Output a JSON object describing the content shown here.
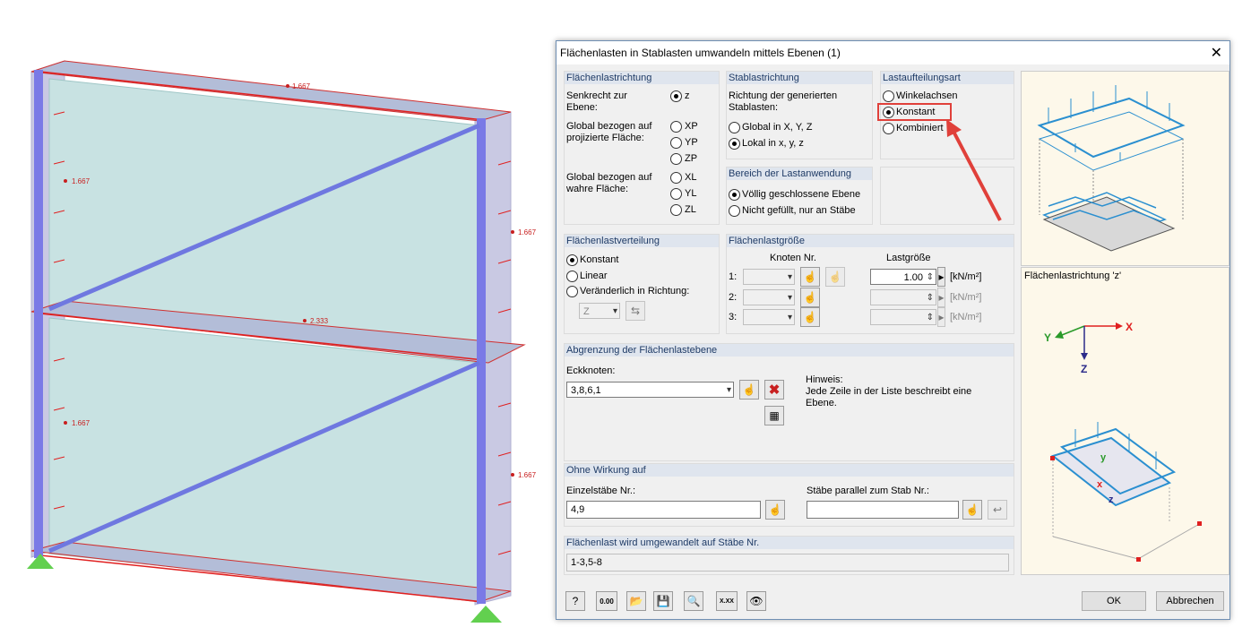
{
  "model": {
    "labels": [
      "1.667",
      "1.667",
      "1.667",
      "2.333",
      "1.667",
      "1.667"
    ]
  },
  "dialog": {
    "title": "Flächenlasten in Stablasten umwandeln mittels Ebenen  (1)",
    "close_glyph": "✕",
    "flaechenlastrichtung": {
      "header": "Flächenlastrichtung",
      "senkrecht": "Senkrecht zur\nEbene:",
      "global_proj": "Global bezogen auf\nprojizierte Fläche:",
      "global_wahr": "Global bezogen auf\nwahre Fläche:",
      "options": [
        "z",
        "XP",
        "YP",
        "ZP",
        "XL",
        "YL",
        "ZL"
      ],
      "selected": "z"
    },
    "stablastrichtung": {
      "header": "Stablastrichtung",
      "richtung": "Richtung der generierten\nStablasten:",
      "options": [
        "Global in X, Y, Z",
        "Lokal in x, y, z"
      ],
      "selected": "Lokal in x, y, z"
    },
    "lastaufteilung": {
      "header": "Lastaufteilungsart",
      "options": [
        "Winkelachsen",
        "Konstant",
        "Kombiniert"
      ],
      "selected": "Konstant"
    },
    "bereich": {
      "header": "Bereich der Lastanwendung",
      "options": [
        "Völlig geschlossene Ebene",
        "Nicht gefüllt, nur an Stäbe"
      ],
      "selected": "Völlig geschlossene Ebene"
    },
    "verteilung": {
      "header": "Flächenlastverteilung",
      "options": [
        "Konstant",
        "Linear",
        "Veränderlich in Richtung:"
      ],
      "selected": "Konstant",
      "direction_value": "Z"
    },
    "groesse": {
      "header": "Flächenlastgröße",
      "knoten_header": "Knoten Nr.",
      "last_header": "Lastgröße",
      "rows": [
        {
          "label": "1:",
          "value": "1.00",
          "unit": "[kN/m²]"
        },
        {
          "label": "2:",
          "value": "",
          "unit": "[kN/m²]"
        },
        {
          "label": "3:",
          "value": "",
          "unit": "[kN/m²]"
        }
      ]
    },
    "abgrenzung": {
      "header": "Abgrenzung der Flächenlastebene",
      "eckknoten_label": "Eckknoten:",
      "eckknoten_value": "3,8,6,1",
      "hinweis": "Hinweis:\nJede Zeile in der Liste beschreibt eine\nEbene."
    },
    "ohne_wirkung": {
      "header": "Ohne Wirkung auf",
      "einzel_label": "Einzelstäbe Nr.:",
      "einzel_value": "4,9",
      "parallel_label": "Stäbe parallel zum Stab Nr.:",
      "parallel_value": ""
    },
    "umgewandelt": {
      "header": "Flächenlast wird umgewandelt auf Stäbe Nr.",
      "value": "1-3,5-8"
    },
    "preview": {
      "caption": "Flächenlastrichtung 'z'",
      "axes": {
        "x": "X",
        "y": "Y",
        "z": "Z"
      },
      "local_axes": {
        "x": "x",
        "y": "y",
        "z": "z"
      }
    },
    "footer": {
      "ok": "OK",
      "cancel": "Abbrechen",
      "calc_label": "0.00",
      "xxx_label": "X.XX"
    }
  },
  "colors": {
    "accent_red": "#e0403a",
    "load_blue": "#2a8fd0",
    "header_text": "#1f3b66"
  }
}
